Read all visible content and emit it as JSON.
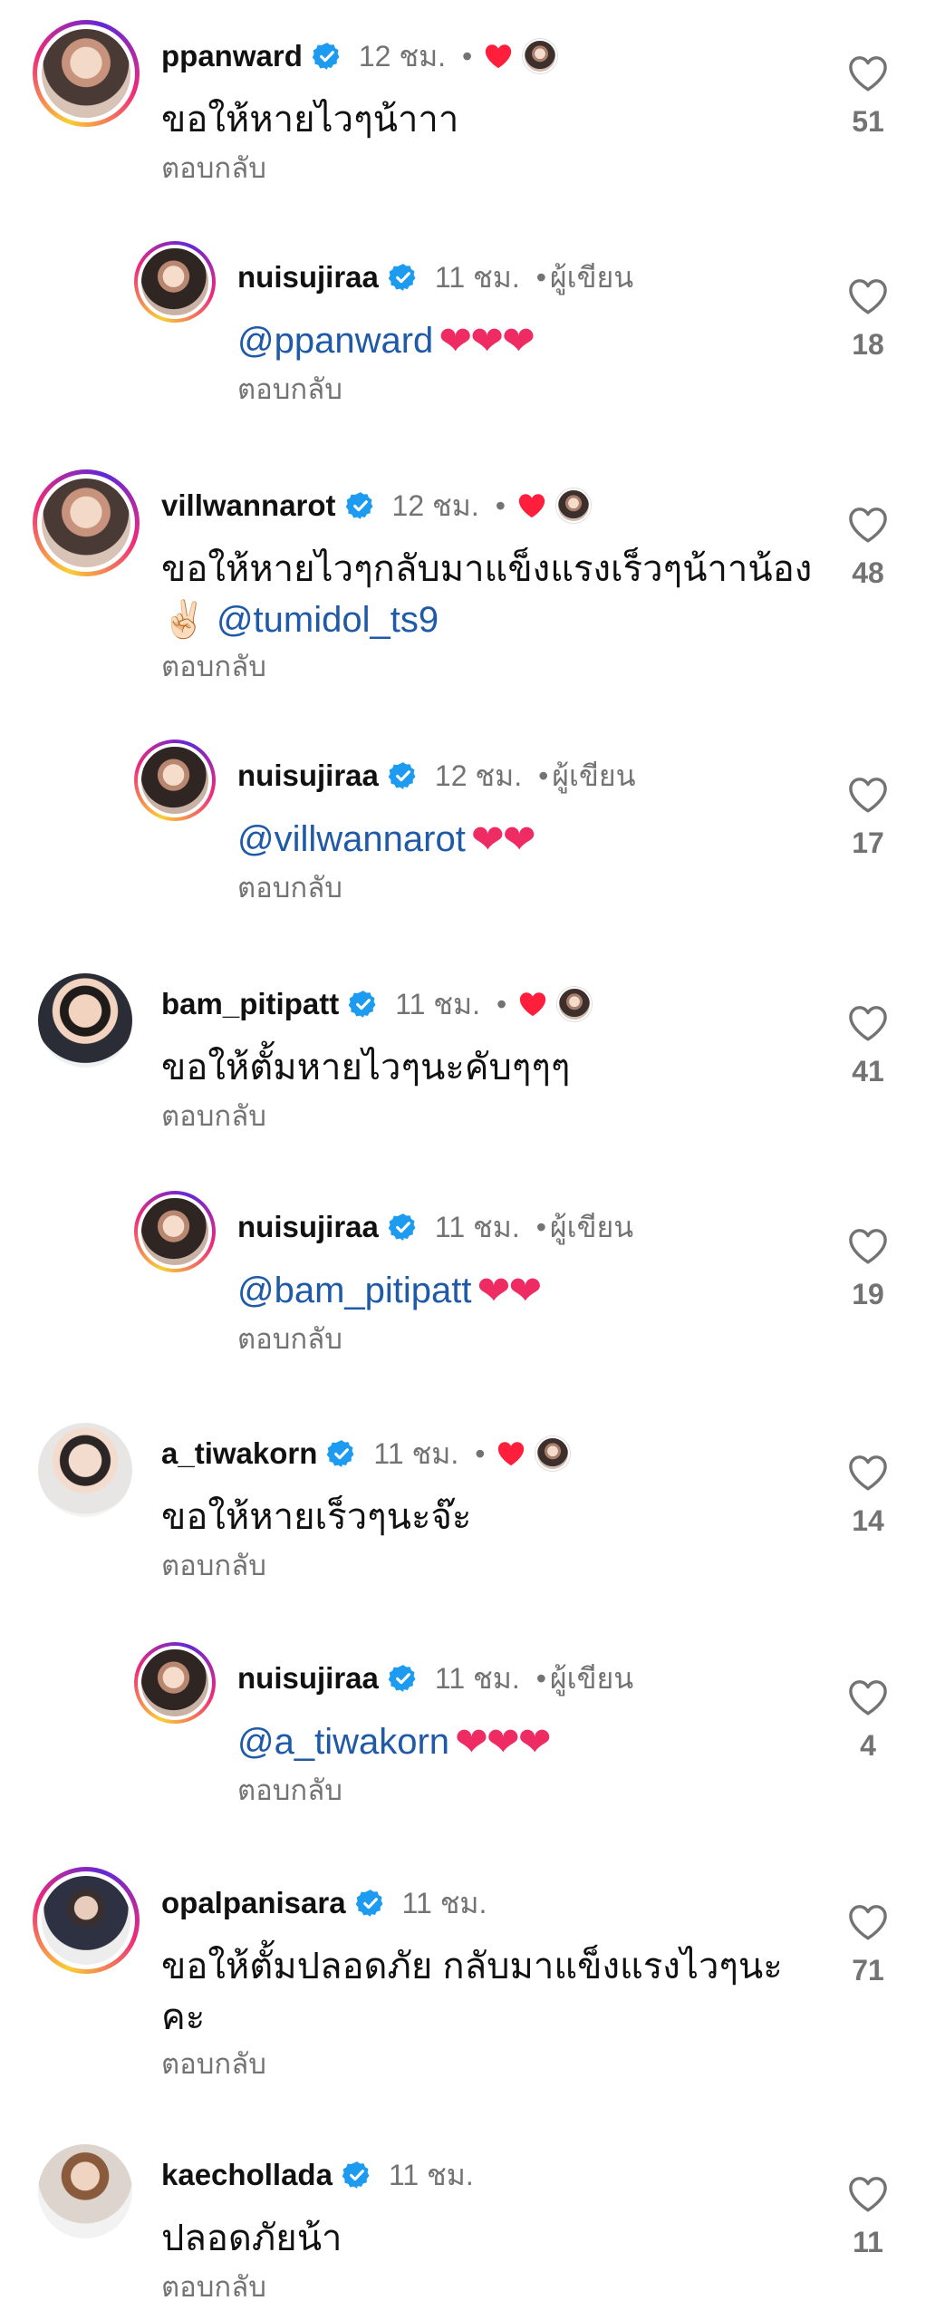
{
  "author_label": "ผู้เขียน",
  "reply_label": "ตอบกลับ",
  "colors": {
    "mention": "#1f5aa8",
    "secondary_text": "#737373",
    "heart": "#ee2b63",
    "verified": "#1d9bf0"
  },
  "comments": [
    {
      "username": "ppanward",
      "time": "12 ชม.",
      "text": "ขอให้หายไวๆน้าาา",
      "likes": "51",
      "liked_by_author": true
    },
    {
      "username": "nuisujiraa",
      "time": "11 ชม.",
      "mention": "@ppanward",
      "emoji": "❤❤❤",
      "likes": "18",
      "is_author": true
    },
    {
      "username": "villwannarot",
      "time": "12 ชม.",
      "text_line1": "ขอให้หายไวๆกลับมาแข็งแรงเร็วๆน้าาน้อง",
      "text_emoji": "✌🏻",
      "mention": "@tumidol_ts9",
      "likes": "48",
      "liked_by_author": true
    },
    {
      "username": "nuisujiraa",
      "time": "12 ชม.",
      "mention": "@villwannarot",
      "emoji": "❤❤",
      "likes": "17",
      "is_author": true
    },
    {
      "username": "bam_pitipatt",
      "time": "11 ชม.",
      "text": "ขอให้ตั้มหายไวๆนะคับๆๆๆ",
      "likes": "41",
      "liked_by_author": true
    },
    {
      "username": "nuisujiraa",
      "time": "11 ชม.",
      "mention": "@bam_pitipatt",
      "emoji": "❤❤",
      "likes": "19",
      "is_author": true
    },
    {
      "username": "a_tiwakorn",
      "time": "11 ชม.",
      "text": "ขอให้หายเร็วๆนะจ๊ะ",
      "likes": "14",
      "liked_by_author": true
    },
    {
      "username": "nuisujiraa",
      "time": "11 ชม.",
      "mention": "@a_tiwakorn",
      "emoji": "❤❤❤",
      "likes": "4",
      "is_author": true
    },
    {
      "username": "opalpanisara",
      "time": "11 ชม.",
      "text_line1": "ขอให้ตั้มปลอดภัย กลับมาแข็งแรงไวๆนะ",
      "text_line2": "คะ",
      "likes": "71"
    },
    {
      "username": "kaechollada",
      "time": "11 ชม.",
      "text": "ปลอดภัยน้า",
      "likes": "11"
    }
  ]
}
